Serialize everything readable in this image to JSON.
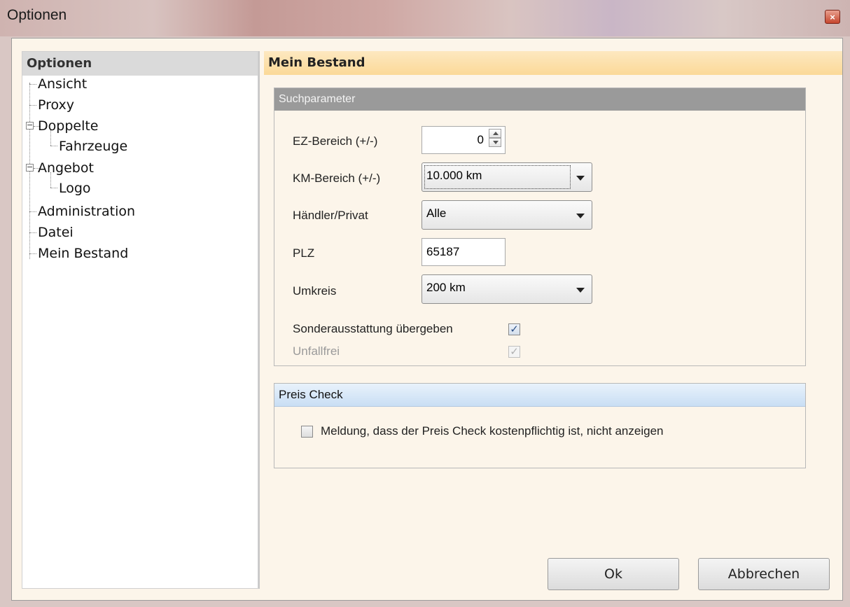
{
  "window": {
    "title": "Optionen",
    "close_symbol": "×"
  },
  "sidebar": {
    "header": "Optionen",
    "items": [
      {
        "label": "Ansicht"
      },
      {
        "label": "Proxy"
      },
      {
        "label": "Doppelte",
        "expander": "−"
      },
      {
        "label": "Fahrzeuge"
      },
      {
        "label": "Angebot",
        "expander": "−"
      },
      {
        "label": "Logo"
      },
      {
        "label": "Administration"
      },
      {
        "label": "Datei"
      },
      {
        "label": "Mein Bestand"
      }
    ]
  },
  "main": {
    "title": "Mein Bestand",
    "suchparameter": {
      "header": "Suchparameter",
      "ez_label": "EZ-Bereich (+/-)",
      "ez_value": "0",
      "km_label": "KM-Bereich (+/-)",
      "km_value": "10.000 km",
      "haendler_label": "Händler/Privat",
      "haendler_value": "Alle",
      "plz_label": "PLZ",
      "plz_value": "65187",
      "umkreis_label": "Umkreis",
      "umkreis_value": "200 km",
      "sonder_label": "Sonderausstattung übergeben",
      "sonder_checked": "✓",
      "unfall_label": "Unfallfrei",
      "unfall_checked": "✓"
    },
    "preis_check": {
      "header": "Preis Check",
      "meldung_label": "Meldung, dass der Preis Check kostenpflichtig ist, nicht anzeigen"
    }
  },
  "buttons": {
    "ok": "Ok",
    "cancel": "Abbrechen"
  }
}
